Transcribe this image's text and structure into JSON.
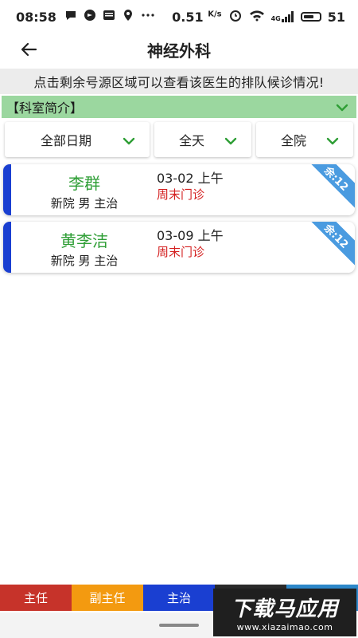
{
  "status_bar": {
    "time": "08:58",
    "network_speed": "0.51",
    "network_unit": "K/s",
    "signal_label": "4G",
    "battery": "51"
  },
  "header": {
    "title": "神经外科"
  },
  "notice": "点击剩余号源区域可以查看该医生的排队候诊情况!",
  "dept_intro": "【科室简介】",
  "filters": {
    "date": "全部日期",
    "time": "全天",
    "campus": "全院"
  },
  "doctors": [
    {
      "name": "李群",
      "info": "新院 男 主治",
      "date": "03-02 上午",
      "clinic": "周末门诊",
      "remaining": "余:12"
    },
    {
      "name": "黄李洁",
      "info": "新院 男 主治",
      "date": "03-09 上午",
      "clinic": "周末门诊",
      "remaining": "余:12"
    }
  ],
  "tabs": [
    "主任",
    "副主任",
    "主治"
  ],
  "watermark": {
    "title": "下载马应用",
    "url": "www.xiazaimao.com"
  },
  "colors": {
    "green_accent": "#9bd79f",
    "doctor_name": "#2e9e35",
    "clinic_red": "#d42020",
    "card_accent": "#1a3fd1",
    "ribbon": "#4a9be0"
  }
}
